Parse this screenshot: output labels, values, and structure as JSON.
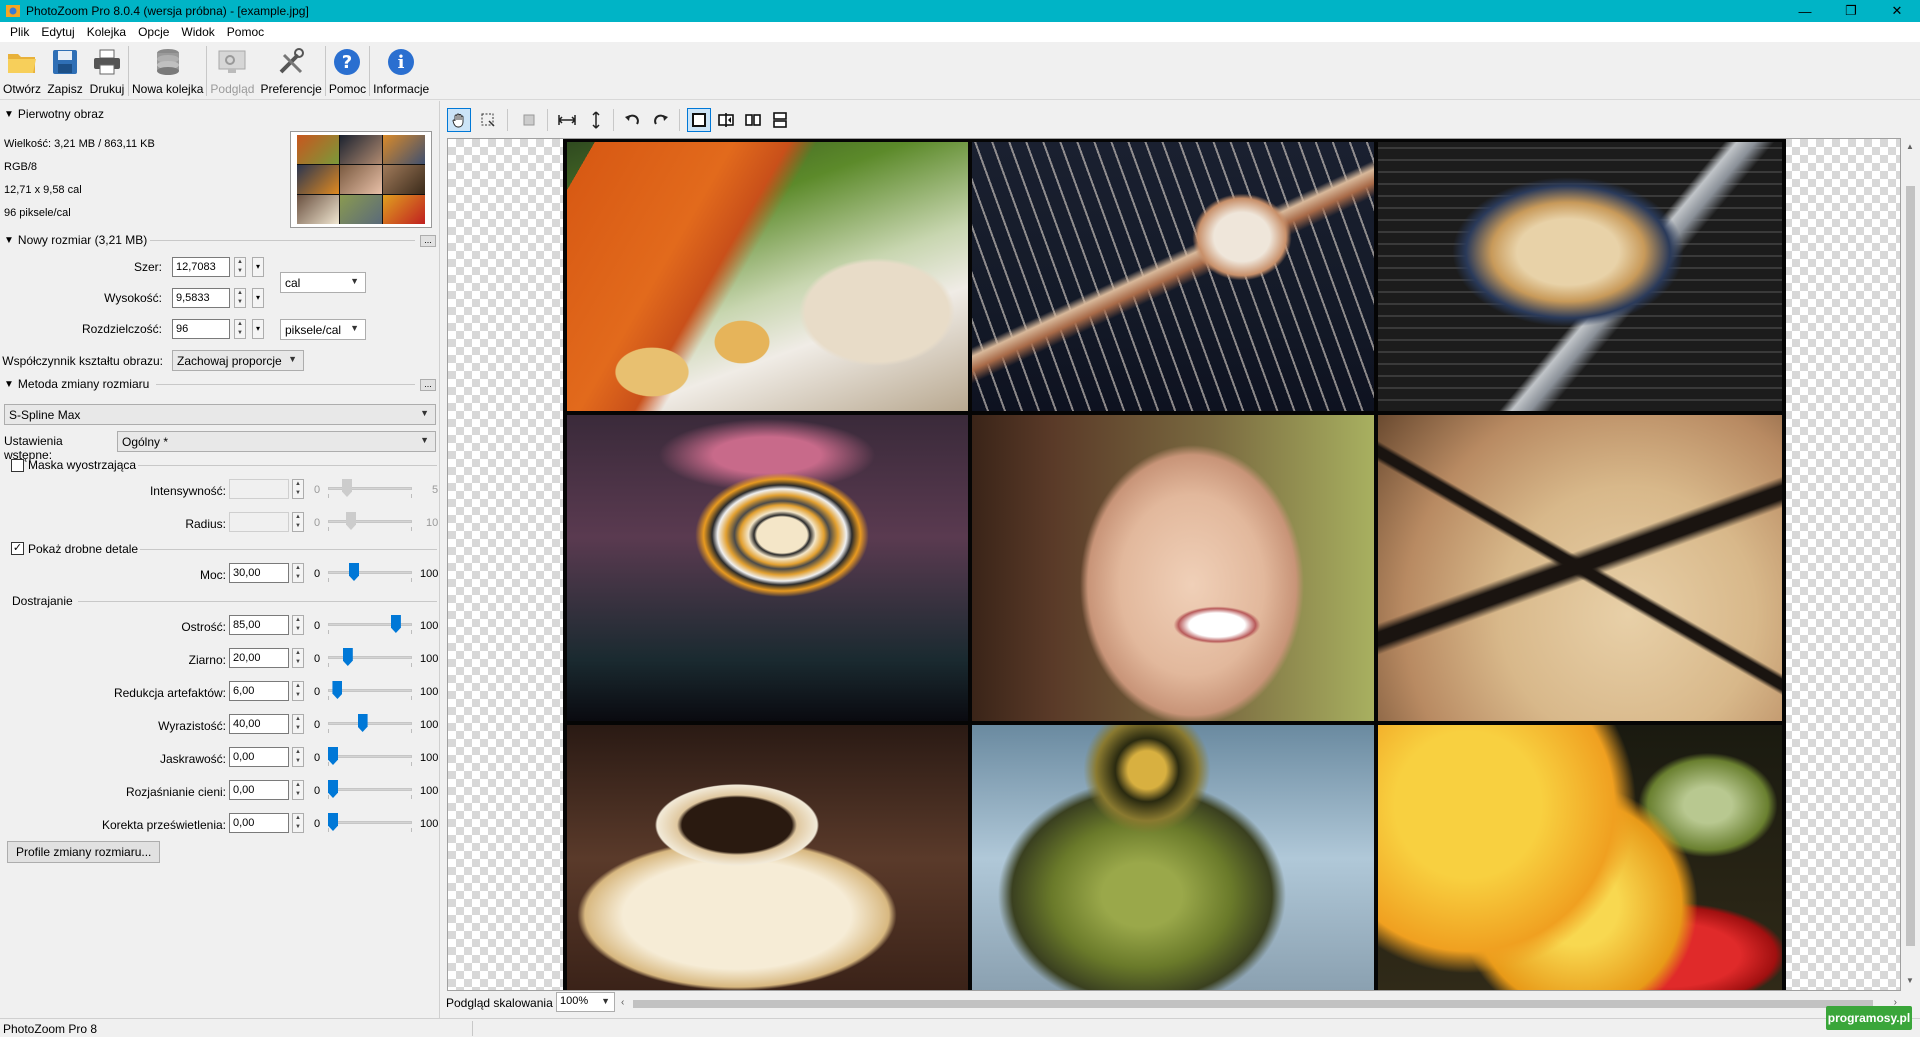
{
  "window": {
    "title": "PhotoZoom Pro 8.0.4 (wersja próbna) - [example.jpg]",
    "minimize_glyph": "—",
    "restore_glyph": "❐",
    "close_glyph": "✕"
  },
  "menu": [
    "Plik",
    "Edytuj",
    "Kolejka",
    "Opcje",
    "Widok",
    "Pomoc"
  ],
  "toolbar": {
    "open": "Otwórz",
    "save": "Zapisz",
    "print": "Drukuj",
    "batch": "Nowa kolejka",
    "preview": "Podgląd",
    "preferences": "Preferencje",
    "help": "Pomoc",
    "info": "Informacje"
  },
  "original": {
    "header": "Pierwotny obraz",
    "size": "Wielkość: 3,21 MB / 863,11 KB",
    "mode": "RGB/8",
    "dimensions": "12,71 x 9,58 cal",
    "resolution": "96 piksele/cal"
  },
  "new_size": {
    "header": "Nowy rozmiar (3,21 MB)",
    "more_button": "...",
    "width_label": "Szer:",
    "width_value": "12,7083",
    "height_label": "Wysokość:",
    "height_value": "9,5833",
    "resolution_label": "Rozdzielczość:",
    "resolution_value": "96",
    "size_unit": "cal",
    "resolution_unit": "piksele/cal",
    "aspect_label": "Współczynnik kształtu obrazu:",
    "aspect_value": "Zachowaj proporcje"
  },
  "method": {
    "header": "Metoda zmiany rozmiaru",
    "more_button": "...",
    "algorithm": "S-Spline Max",
    "preset_label": "Ustawienia wstępne:",
    "preset_value": "Ogólny *",
    "sharpen_mask_label": "Maska wyostrzająca",
    "sharpen_mask_checked": false,
    "intensity_label": "Intensywność:",
    "intensity_value": "",
    "intensity_min": "0",
    "intensity_max": "5",
    "radius_label": "Radius:",
    "radius_value": "",
    "radius_min": "0",
    "radius_max": "10",
    "fine_detail_label": "Pokaż drobne detale",
    "fine_detail_checked": true,
    "strength_label": "Moc:",
    "strength_value": "30,00",
    "strength_min": "0",
    "strength_max": "100",
    "tuning_header": "Dostrajanie",
    "tuning": [
      {
        "label": "Ostrość:",
        "value": "85,00",
        "min": "0",
        "max": "100",
        "level": 0.85
      },
      {
        "label": "Ziarno:",
        "value": "20,00",
        "min": "0",
        "max": "100",
        "level": 0.2
      },
      {
        "label": "Redukcja artefaktów:",
        "value": "6,00",
        "min": "0",
        "max": "100",
        "level": 0.06
      },
      {
        "label": "Wyrazistość:",
        "value": "40,00",
        "min": "0",
        "max": "100",
        "level": 0.4
      },
      {
        "label": "Jaskrawość:",
        "value": "0,00",
        "min": "0",
        "max": "100",
        "level": 0.0
      },
      {
        "label": "Rozjaśnianie cieni:",
        "value": "0,00",
        "min": "0",
        "max": "100",
        "level": 0.0
      },
      {
        "label": "Korekta prześwietlenia:",
        "value": "0,00",
        "min": "0",
        "max": "100",
        "level": 0.0
      }
    ],
    "profiles_button": "Profile zmiany rozmiaru..."
  },
  "preview": {
    "zoom_label": "Podgląd skalowania",
    "zoom_value": "100%"
  },
  "status": {
    "text": "PhotoZoom Pro 8",
    "watermark": "programosy.pl"
  }
}
